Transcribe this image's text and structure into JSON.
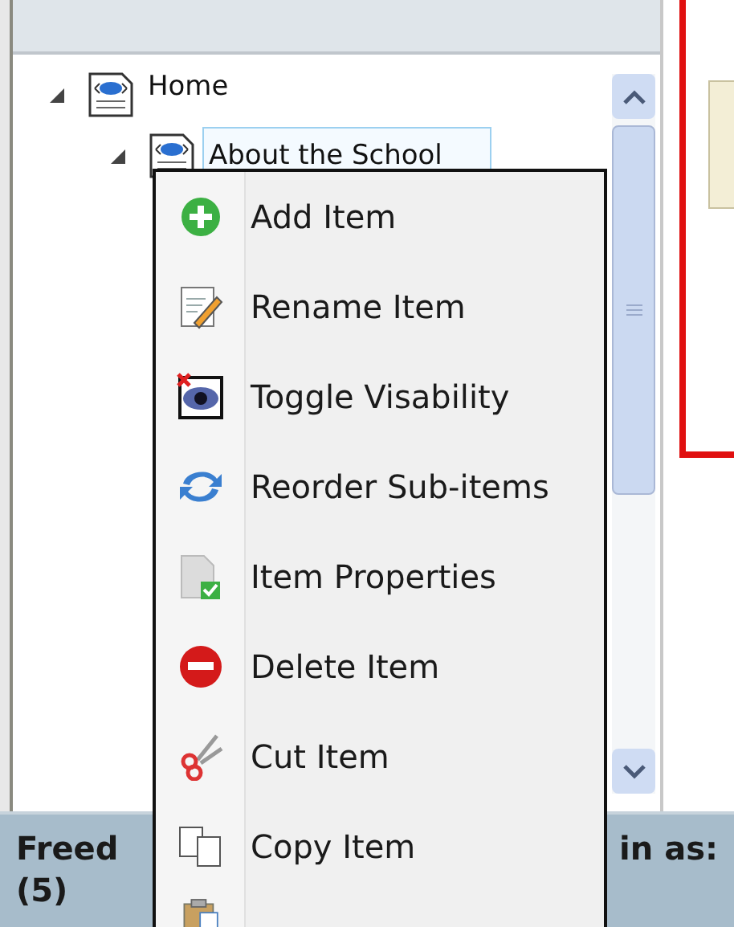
{
  "tree": [
    {
      "label": "Home",
      "expanded": true,
      "selected": false,
      "children": [
        {
          "label": "About the School",
          "expanded": true,
          "selected": true
        }
      ]
    }
  ],
  "context_menu": {
    "items": [
      {
        "kind": "add",
        "label": "Add Item"
      },
      {
        "kind": "rename",
        "label": "Rename Item"
      },
      {
        "kind": "visibility",
        "label": "Toggle Visability"
      },
      {
        "kind": "reorder",
        "label": "Reorder Sub-items"
      },
      {
        "kind": "properties",
        "label": "Item Properties"
      },
      {
        "kind": "delete",
        "label": "Delete Item"
      },
      {
        "kind": "cut",
        "label": "Cut Item"
      },
      {
        "kind": "copy",
        "label": "Copy Item"
      },
      {
        "kind": "paste"
      }
    ]
  },
  "status_bar": {
    "left": "Freed",
    "right": "in as:",
    "second_line": "(5)"
  }
}
